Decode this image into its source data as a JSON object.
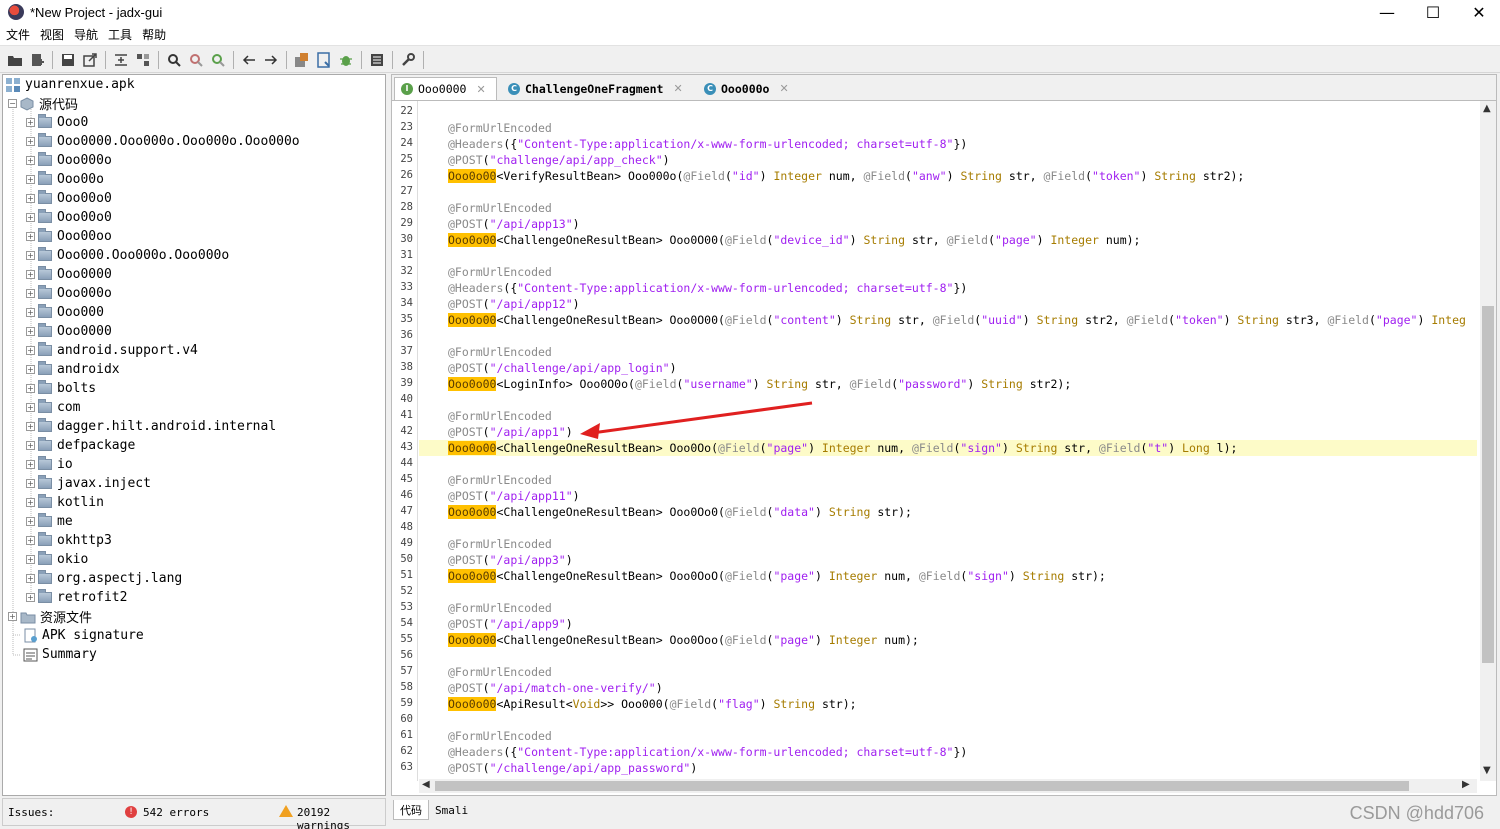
{
  "window": {
    "title": "*New Project - jadx-gui",
    "minimize": "—",
    "maximize": "☐",
    "close": "✕"
  },
  "menu": [
    "文件",
    "视图",
    "导航",
    "工具",
    "帮助"
  ],
  "tree": {
    "root": "yuanrenxue.apk",
    "source_label": "源代码",
    "packages": [
      "Ooo0",
      "Ooo0000.Ooo000o.Ooo000o.Ooo000o",
      "Ooo000o",
      "Ooo00o",
      "Ooo00o0",
      "Ooo00o0",
      "Ooo00oo",
      "Ooo000.Ooo000o.Ooo000o",
      "Ooo0000",
      "Ooo000o",
      "Ooo000",
      "Ooo0000",
      "android.support.v4",
      "androidx",
      "bolts",
      "com",
      "dagger.hilt.android.internal",
      "defpackage",
      "io",
      "javax.inject",
      "kotlin",
      "me",
      "okhttp3",
      "okio",
      "org.aspectj.lang",
      "retrofit2"
    ],
    "resources_label": "资源文件",
    "apk_signature": "APK signature",
    "summary": "Summary"
  },
  "issues": {
    "label": "Issues:",
    "errors": "542 errors",
    "warnings": "20192 warnings"
  },
  "tabs": [
    {
      "label": "Ooo0000",
      "icon": "I",
      "color": "#5aa04a"
    },
    {
      "label": "ChallengeOneFragment",
      "icon": "C",
      "color": "#3a8fb8"
    },
    {
      "label": "Ooo000o",
      "icon": "C",
      "color": "#3a8fb8"
    }
  ],
  "bottom_tabs": [
    "代码",
    "Smali"
  ],
  "watermark": "CSDN @hdd706",
  "code": {
    "first_line": 22,
    "highlight_line": 43,
    "lines": [
      [],
      [
        [
          "a",
          "@FormUrlEncoded"
        ]
      ],
      [
        [
          "a",
          "@Headers"
        ],
        [
          "p",
          "({"
        ],
        [
          "s",
          "\"Content-Type:application/x-www-form-urlencoded; charset=utf-8\""
        ],
        [
          "p",
          "})"
        ]
      ],
      [
        [
          "a",
          "@POST"
        ],
        [
          "p",
          "("
        ],
        [
          "s",
          "\"challenge/api/app_check\""
        ],
        [
          "p",
          ")"
        ]
      ],
      [
        [
          "m",
          "Ooo0o00"
        ],
        [
          "p",
          "<VerifyResultBean> Ooo000o("
        ],
        [
          "a",
          "@Field"
        ],
        [
          "p",
          "("
        ],
        [
          "s",
          "\"id\""
        ],
        [
          "p",
          ") "
        ],
        [
          "t",
          "Integer"
        ],
        [
          "p",
          " num, "
        ],
        [
          "a",
          "@Field"
        ],
        [
          "p",
          "("
        ],
        [
          "s",
          "\"anw\""
        ],
        [
          "p",
          ") "
        ],
        [
          "t",
          "String"
        ],
        [
          "p",
          " str, "
        ],
        [
          "a",
          "@Field"
        ],
        [
          "p",
          "("
        ],
        [
          "s",
          "\"token\""
        ],
        [
          "p",
          ") "
        ],
        [
          "t",
          "String"
        ],
        [
          "p",
          " str2);"
        ]
      ],
      [],
      [
        [
          "a",
          "@FormUrlEncoded"
        ]
      ],
      [
        [
          "a",
          "@POST"
        ],
        [
          "p",
          "("
        ],
        [
          "s",
          "\"/api/app13\""
        ],
        [
          "p",
          ")"
        ]
      ],
      [
        [
          "m",
          "Ooo0o00"
        ],
        [
          "p",
          "<ChallengeOneResultBean> Ooo0O00("
        ],
        [
          "a",
          "@Field"
        ],
        [
          "p",
          "("
        ],
        [
          "s",
          "\"device_id\""
        ],
        [
          "p",
          ") "
        ],
        [
          "t",
          "String"
        ],
        [
          "p",
          " str, "
        ],
        [
          "a",
          "@Field"
        ],
        [
          "p",
          "("
        ],
        [
          "s",
          "\"page\""
        ],
        [
          "p",
          ") "
        ],
        [
          "t",
          "Integer"
        ],
        [
          "p",
          " num);"
        ]
      ],
      [],
      [
        [
          "a",
          "@FormUrlEncoded"
        ]
      ],
      [
        [
          "a",
          "@Headers"
        ],
        [
          "p",
          "({"
        ],
        [
          "s",
          "\"Content-Type:application/x-www-form-urlencoded; charset=utf-8\""
        ],
        [
          "p",
          "})"
        ]
      ],
      [
        [
          "a",
          "@POST"
        ],
        [
          "p",
          "("
        ],
        [
          "s",
          "\"/api/app12\""
        ],
        [
          "p",
          ")"
        ]
      ],
      [
        [
          "m",
          "Ooo0o00"
        ],
        [
          "p",
          "<ChallengeOneResultBean> Ooo0O00("
        ],
        [
          "a",
          "@Field"
        ],
        [
          "p",
          "("
        ],
        [
          "s",
          "\"content\""
        ],
        [
          "p",
          ") "
        ],
        [
          "t",
          "String"
        ],
        [
          "p",
          " str, "
        ],
        [
          "a",
          "@Field"
        ],
        [
          "p",
          "("
        ],
        [
          "s",
          "\"uuid\""
        ],
        [
          "p",
          ") "
        ],
        [
          "t",
          "String"
        ],
        [
          "p",
          " str2, "
        ],
        [
          "a",
          "@Field"
        ],
        [
          "p",
          "("
        ],
        [
          "s",
          "\"token\""
        ],
        [
          "p",
          ") "
        ],
        [
          "t",
          "String"
        ],
        [
          "p",
          " str3, "
        ],
        [
          "a",
          "@Field"
        ],
        [
          "p",
          "("
        ],
        [
          "s",
          "\"page\""
        ],
        [
          "p",
          ") "
        ],
        [
          "t",
          "Integ"
        ]
      ],
      [],
      [
        [
          "a",
          "@FormUrlEncoded"
        ]
      ],
      [
        [
          "a",
          "@POST"
        ],
        [
          "p",
          "("
        ],
        [
          "s",
          "\"/challenge/api/app_login\""
        ],
        [
          "p",
          ")"
        ]
      ],
      [
        [
          "m",
          "Ooo0o00"
        ],
        [
          "p",
          "<LoginInfo> Ooo0O0o("
        ],
        [
          "a",
          "@Field"
        ],
        [
          "p",
          "("
        ],
        [
          "s",
          "\"username\""
        ],
        [
          "p",
          ") "
        ],
        [
          "t",
          "String"
        ],
        [
          "p",
          " str, "
        ],
        [
          "a",
          "@Field"
        ],
        [
          "p",
          "("
        ],
        [
          "s",
          "\"password\""
        ],
        [
          "p",
          ") "
        ],
        [
          "t",
          "String"
        ],
        [
          "p",
          " str2);"
        ]
      ],
      [],
      [
        [
          "a",
          "@FormUrlEncoded"
        ]
      ],
      [
        [
          "a",
          "@POST"
        ],
        [
          "p",
          "("
        ],
        [
          "s",
          "\"/api/app1\""
        ],
        [
          "p",
          ")"
        ]
      ],
      [
        [
          "m",
          "Ooo0o00"
        ],
        [
          "p",
          "<ChallengeOneResultBean> Ooo0Oo("
        ],
        [
          "a",
          "@Field"
        ],
        [
          "p",
          "("
        ],
        [
          "s",
          "\"page\""
        ],
        [
          "p",
          ") "
        ],
        [
          "t",
          "Integer"
        ],
        [
          "p",
          " num, "
        ],
        [
          "a",
          "@Field"
        ],
        [
          "p",
          "("
        ],
        [
          "s",
          "\"sign\""
        ],
        [
          "p",
          ") "
        ],
        [
          "t",
          "String"
        ],
        [
          "p",
          " str, "
        ],
        [
          "a",
          "@Field"
        ],
        [
          "p",
          "("
        ],
        [
          "s",
          "\"t\""
        ],
        [
          "p",
          ") "
        ],
        [
          "t",
          "Long"
        ],
        [
          "p",
          " l);"
        ]
      ],
      [],
      [
        [
          "a",
          "@FormUrlEncoded"
        ]
      ],
      [
        [
          "a",
          "@POST"
        ],
        [
          "p",
          "("
        ],
        [
          "s",
          "\"/api/app11\""
        ],
        [
          "p",
          ")"
        ]
      ],
      [
        [
          "m",
          "Ooo0o00"
        ],
        [
          "p",
          "<ChallengeOneResultBean> Ooo0Oo0("
        ],
        [
          "a",
          "@Field"
        ],
        [
          "p",
          "("
        ],
        [
          "s",
          "\"data\""
        ],
        [
          "p",
          ") "
        ],
        [
          "t",
          "String"
        ],
        [
          "p",
          " str);"
        ]
      ],
      [],
      [
        [
          "a",
          "@FormUrlEncoded"
        ]
      ],
      [
        [
          "a",
          "@POST"
        ],
        [
          "p",
          "("
        ],
        [
          "s",
          "\"/api/app3\""
        ],
        [
          "p",
          ")"
        ]
      ],
      [
        [
          "m",
          "Ooo0o00"
        ],
        [
          "p",
          "<ChallengeOneResultBean> Ooo0OoO("
        ],
        [
          "a",
          "@Field"
        ],
        [
          "p",
          "("
        ],
        [
          "s",
          "\"page\""
        ],
        [
          "p",
          ") "
        ],
        [
          "t",
          "Integer"
        ],
        [
          "p",
          " num, "
        ],
        [
          "a",
          "@Field"
        ],
        [
          "p",
          "("
        ],
        [
          "s",
          "\"sign\""
        ],
        [
          "p",
          ") "
        ],
        [
          "t",
          "String"
        ],
        [
          "p",
          " str);"
        ]
      ],
      [],
      [
        [
          "a",
          "@FormUrlEncoded"
        ]
      ],
      [
        [
          "a",
          "@POST"
        ],
        [
          "p",
          "("
        ],
        [
          "s",
          "\"/api/app9\""
        ],
        [
          "p",
          ")"
        ]
      ],
      [
        [
          "m",
          "Ooo0o00"
        ],
        [
          "p",
          "<ChallengeOneResultBean> Ooo0Ooo("
        ],
        [
          "a",
          "@Field"
        ],
        [
          "p",
          "("
        ],
        [
          "s",
          "\"page\""
        ],
        [
          "p",
          ") "
        ],
        [
          "t",
          "Integer"
        ],
        [
          "p",
          " num);"
        ]
      ],
      [],
      [
        [
          "a",
          "@FormUrlEncoded"
        ]
      ],
      [
        [
          "a",
          "@POST"
        ],
        [
          "p",
          "("
        ],
        [
          "s",
          "\"/api/match-one-verify/\""
        ],
        [
          "p",
          ")"
        ]
      ],
      [
        [
          "m",
          "Ooo0o00"
        ],
        [
          "p",
          "<ApiResult<"
        ],
        [
          "t",
          "Void"
        ],
        [
          "p",
          ">> Ooo000("
        ],
        [
          "a",
          "@Field"
        ],
        [
          "p",
          "("
        ],
        [
          "s",
          "\"flag\""
        ],
        [
          "p",
          ") "
        ],
        [
          "t",
          "String"
        ],
        [
          "p",
          " str);"
        ]
      ],
      [],
      [
        [
          "a",
          "@FormUrlEncoded"
        ]
      ],
      [
        [
          "a",
          "@Headers"
        ],
        [
          "p",
          "({"
        ],
        [
          "s",
          "\"Content-Type:application/x-www-form-urlencoded; charset=utf-8\""
        ],
        [
          "p",
          "})"
        ]
      ],
      [
        [
          "a",
          "@POST"
        ],
        [
          "p",
          "("
        ],
        [
          "s",
          "\"/challenge/api/app_password\""
        ],
        [
          "p",
          ")"
        ]
      ]
    ]
  },
  "colors": {
    "annotation": "#8a8a8a",
    "string": "#a020f0",
    "type": "#a67c00",
    "highlight_mark": "#ffc000",
    "current_line": "#fdfbc8",
    "arrow": "#e02020"
  }
}
